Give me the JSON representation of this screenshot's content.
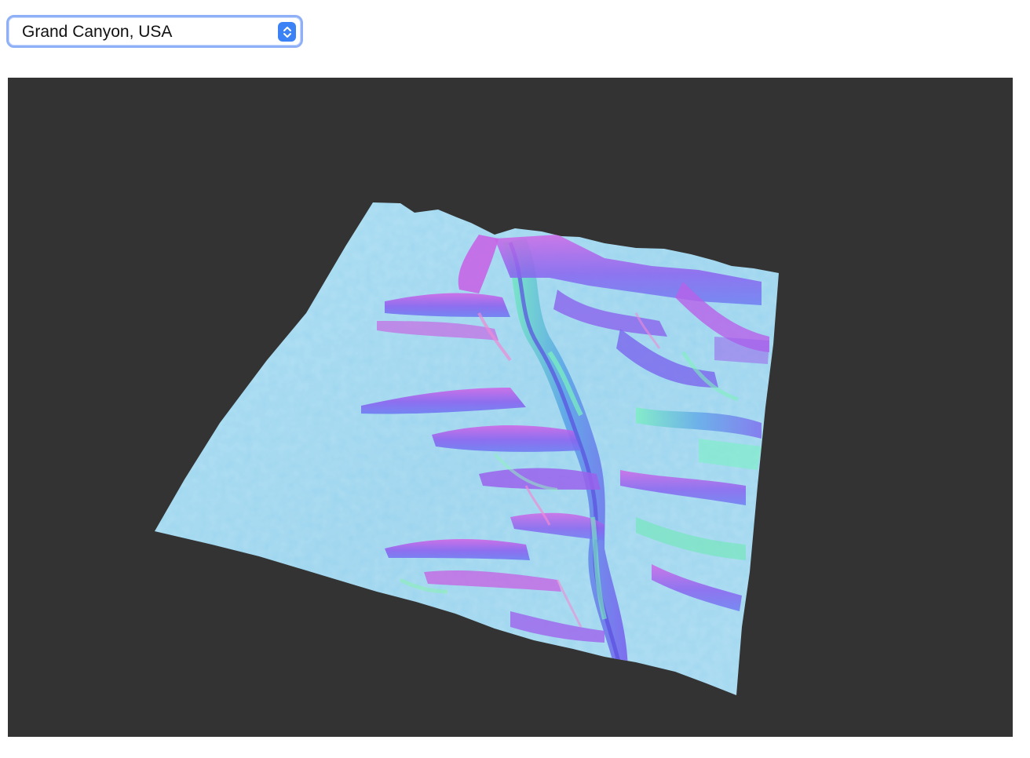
{
  "location_select": {
    "selected": "Grand Canyon, USA",
    "icon": "up-down-chevron-icon"
  },
  "viewport": {
    "background": "#333333",
    "render_style": "normal-map shaded terrain",
    "terrain_colors": {
      "flat": "#9fd6f0",
      "north_slope": "#c260e8",
      "west_slope": "#7a6cf0",
      "south_slope": "#7ef0b8",
      "highlight": "#f08ad6"
    }
  }
}
